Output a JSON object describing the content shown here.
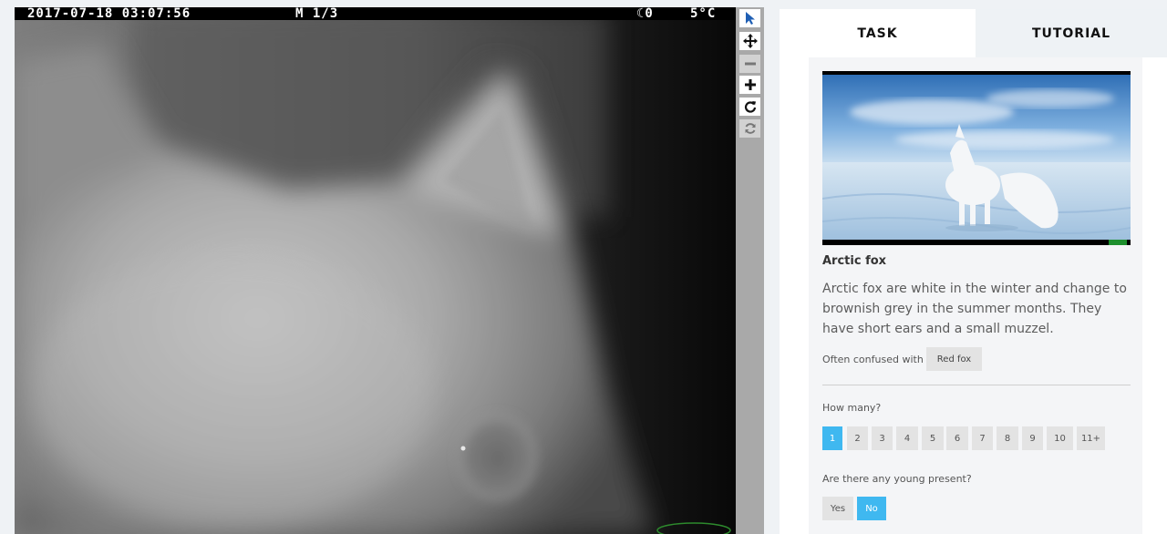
{
  "camera": {
    "timestamp": "2017-07-18 03:07:56",
    "mode": "M 1/3",
    "moon": "☾0",
    "temperature": "5°C"
  },
  "toolbar": {
    "tools": [
      {
        "name": "select-tool",
        "icon": "cursor-arrow-icon",
        "state": "active"
      },
      {
        "name": "pan-tool",
        "icon": "move-arrows-icon",
        "state": "enabled"
      },
      {
        "name": "zoom-out-tool",
        "icon": "minus-icon",
        "state": "disabled"
      },
      {
        "name": "zoom-in-tool",
        "icon": "plus-icon",
        "state": "enabled"
      },
      {
        "name": "rotate-tool",
        "icon": "rotate-icon",
        "state": "enabled"
      },
      {
        "name": "reset-tool",
        "icon": "refresh-icon",
        "state": "disabled"
      }
    ]
  },
  "tabs": {
    "task": "TASK",
    "tutorial": "TUTORIAL",
    "active": "task"
  },
  "species": {
    "name": "Arctic fox",
    "description": "Arctic fox are white in the winter and change to brownish grey in the summer months. They have short ears and a small muzzel.",
    "confused_label": "Often confused with",
    "confused_with": "Red fox"
  },
  "questions": {
    "how_many": {
      "label": "How many?",
      "options": [
        "1",
        "2",
        "3",
        "4",
        "5",
        "6",
        "7",
        "8",
        "9",
        "10",
        "11+"
      ],
      "selected": "1"
    },
    "young": {
      "label": "Are there any young present?",
      "options": [
        "Yes",
        "No"
      ],
      "selected": "No"
    }
  },
  "colors": {
    "accent": "#3fb8f0",
    "panel_bg": "#f4f5f7",
    "tab_inactive_bg": "#eef2f5"
  }
}
